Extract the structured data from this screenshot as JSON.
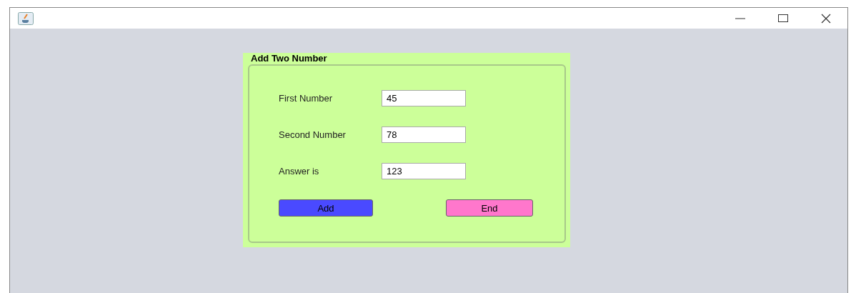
{
  "panel": {
    "title": "Add Two Number",
    "fields": [
      {
        "label": "First Number",
        "value": "45"
      },
      {
        "label": "Second Number",
        "value": "78"
      },
      {
        "label": "Answer is",
        "value": "123"
      }
    ],
    "buttons": [
      {
        "label": "Add",
        "color": "#4a4aff"
      },
      {
        "label": "End",
        "color": "#ff77cc"
      }
    ]
  }
}
